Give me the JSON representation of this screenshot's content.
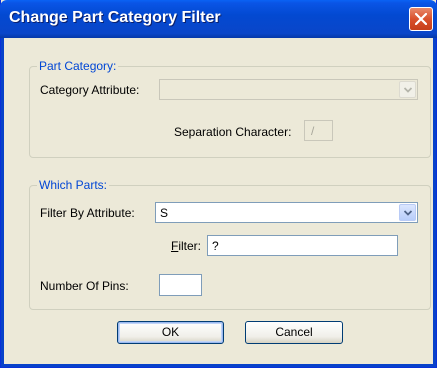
{
  "window": {
    "title": "Change Part Category Filter"
  },
  "part_category": {
    "legend": "Part Category:",
    "attribute_label": "Category Attribute:",
    "attribute_value": "",
    "separation_label": "Separation Character:",
    "separation_value": "/"
  },
  "which_parts": {
    "legend": "Which Parts:",
    "filter_by_label": "Filter By Attribute:",
    "filter_by_value": "S",
    "filter_label_underlined": "F",
    "filter_label_rest": "ilter:",
    "filter_value": "?",
    "pins_label": "Number Of Pins:",
    "pins_value": ""
  },
  "buttons": {
    "ok": "OK",
    "cancel": "Cancel"
  },
  "icons": {
    "close": "close-icon",
    "dropdown": "chevron-down-icon"
  }
}
